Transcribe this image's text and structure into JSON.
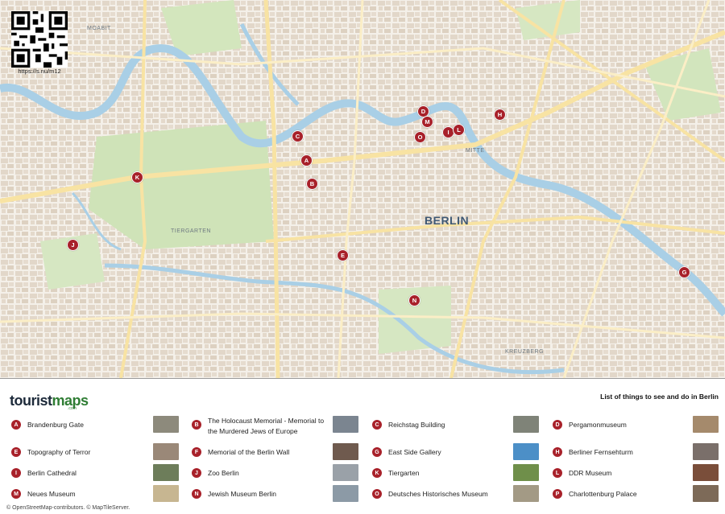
{
  "qr": {
    "url": "https://s.nu/m12"
  },
  "map": {
    "city": "BERLIN",
    "districts": [
      {
        "name": "MOABIT"
      },
      {
        "name": "TIERGARTEN"
      },
      {
        "name": "MITTE"
      },
      {
        "name": "KREUZBERG"
      }
    ],
    "markers": [
      "A",
      "B",
      "C",
      "D",
      "E",
      "G",
      "H",
      "I",
      "J",
      "K",
      "L",
      "M",
      "N",
      "O"
    ]
  },
  "legend": {
    "logo_part1": "tourist",
    "logo_part2": "maps",
    "logo_sub": ".com",
    "title": "List of things to see and do in Berlin",
    "items": [
      {
        "letter": "A",
        "name": "Brandenburg Gate",
        "thumb_color": "#8d8a7c"
      },
      {
        "letter": "B",
        "name": "The Holocaust Memorial - Memorial to the Murdered Jews of Europe",
        "thumb_color": "#7b8590"
      },
      {
        "letter": "C",
        "name": "Reichstag Building",
        "thumb_color": "#7f8378"
      },
      {
        "letter": "D",
        "name": "Pergamonmuseum",
        "thumb_color": "#a58a6c"
      },
      {
        "letter": "E",
        "name": "Topography of Terror",
        "thumb_color": "#9a8878"
      },
      {
        "letter": "F",
        "name": "Memorial of the Berlin Wall",
        "thumb_color": "#6f5a4e"
      },
      {
        "letter": "G",
        "name": "East Side Gallery",
        "thumb_color": "#4c8fc7"
      },
      {
        "letter": "H",
        "name": "Berliner Fernsehturm",
        "thumb_color": "#7a6f6a"
      },
      {
        "letter": "I",
        "name": "Berlin Cathedral",
        "thumb_color": "#6d7d5a"
      },
      {
        "letter": "J",
        "name": "Zoo Berlin",
        "thumb_color": "#9aa1a8"
      },
      {
        "letter": "K",
        "name": "Tiergarten",
        "thumb_color": "#6f8f4a"
      },
      {
        "letter": "L",
        "name": "DDR Museum",
        "thumb_color": "#7a4e3a"
      },
      {
        "letter": "M",
        "name": "Neues Museum",
        "thumb_color": "#c7b691"
      },
      {
        "letter": "N",
        "name": "Jewish Museum Berlin",
        "thumb_color": "#8c9aa6"
      },
      {
        "letter": "O",
        "name": "Deutsches Historisches Museum",
        "thumb_color": "#a39a85"
      },
      {
        "letter": "P",
        "name": "Charlottenburg Palace",
        "thumb_color": "#7d6a58"
      }
    ]
  },
  "credit": "© OpenStreetMap-contributors. © MapTileServer."
}
